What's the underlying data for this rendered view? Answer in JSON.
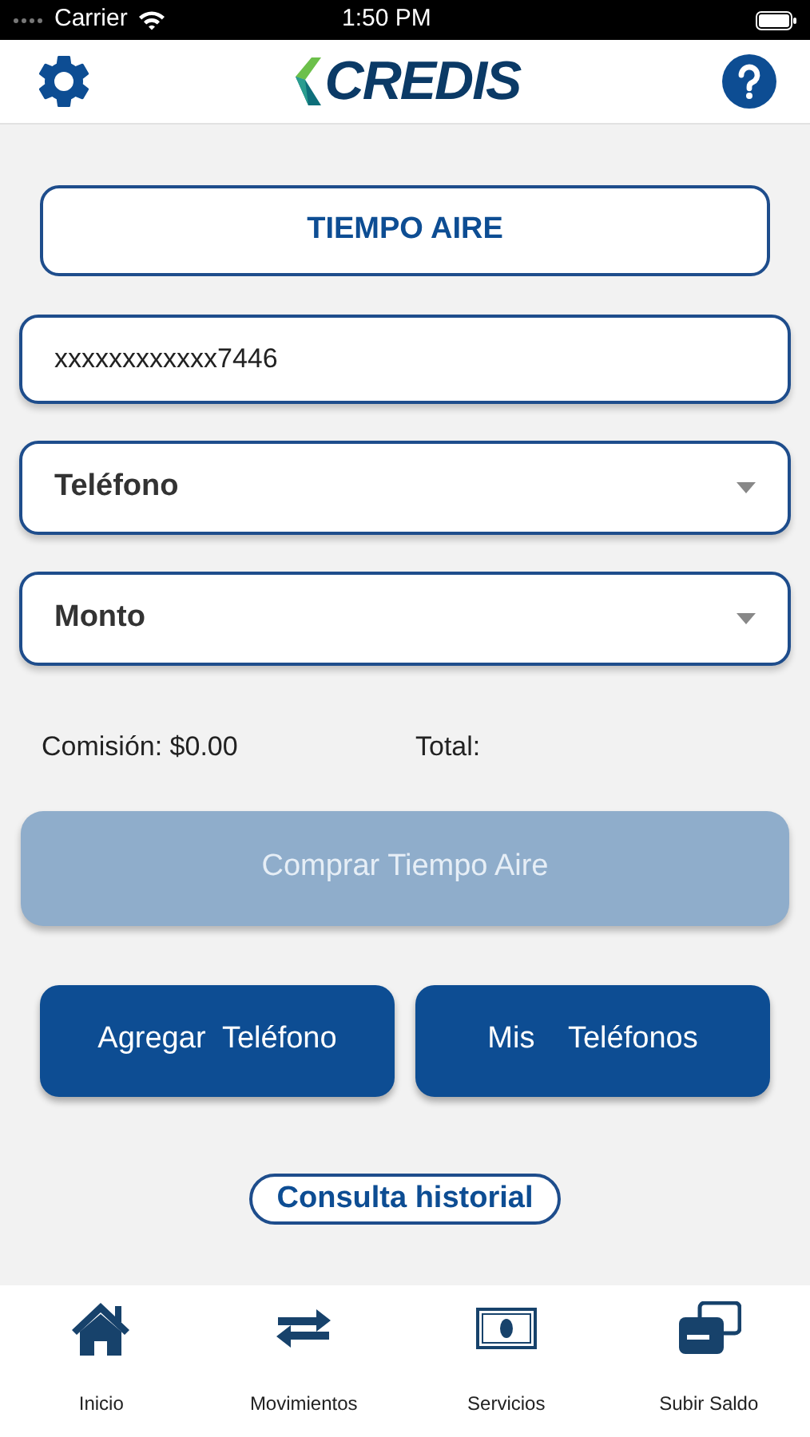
{
  "status_bar": {
    "carrier": "Carrier",
    "time": "1:50 PM"
  },
  "header": {
    "logo": "CREDIS"
  },
  "section_title": "TIEMPO AIRE",
  "card_field": {
    "value": "xxxxxxxxxxxx7446"
  },
  "dropdowns": [
    {
      "label": "Teléfono"
    },
    {
      "label": "Monto"
    }
  ],
  "commission": "Comisión: $0.00",
  "total": "Total:",
  "buy_button": {
    "label": "Comprar Tiempo Aire",
    "disabled": true
  },
  "buttons": [
    {
      "label": "Agregar  Teléfono"
    },
    {
      "label": "Mis    Teléfonos"
    }
  ],
  "history_link": "Consulta historial",
  "tabs": [
    {
      "label": "Inicio",
      "kind": "home"
    },
    {
      "label": "Movimientos",
      "kind": "transfer"
    },
    {
      "label": "Servicios",
      "kind": "bill"
    },
    {
      "label": "Subir Saldo",
      "kind": "cards"
    }
  ]
}
